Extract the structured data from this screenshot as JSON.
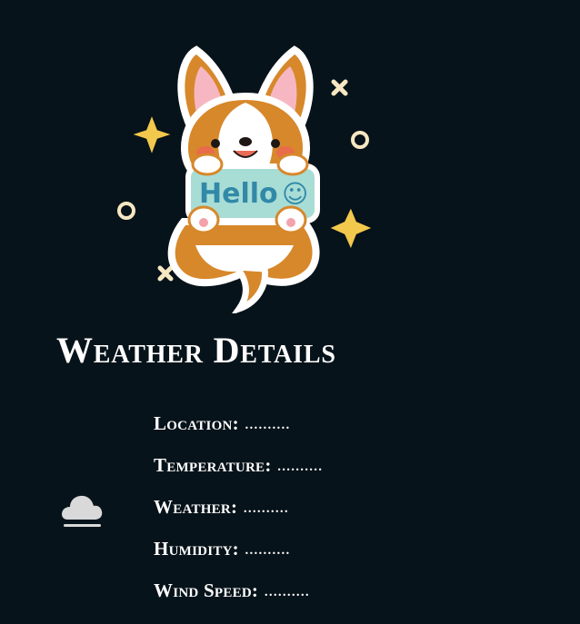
{
  "title": "Weather Details",
  "illustration": {
    "sign_text": "Hello",
    "sign_face": "☺"
  },
  "weather_icon": "cloud-icon",
  "details": [
    {
      "label": "Location:",
      "value": ".........."
    },
    {
      "label": "Temperature:",
      "value": ".........."
    },
    {
      "label": "Weather:",
      "value": ".........."
    },
    {
      "label": "Humidity:",
      "value": ".........."
    },
    {
      "label": "Wind Speed:",
      "value": ".........."
    }
  ],
  "colors": {
    "background": "#07131a",
    "text": "#ffffff",
    "corgi_orange": "#d7882b",
    "sign": "#a8ddd6",
    "sparkle": "#f2c94c"
  }
}
